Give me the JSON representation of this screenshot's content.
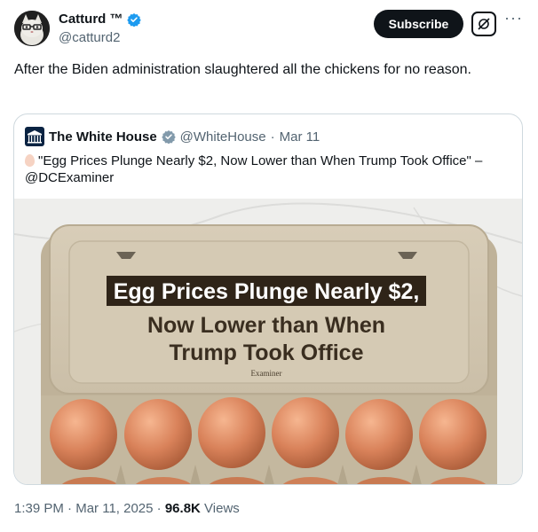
{
  "tweet": {
    "author_name": "Catturd ™",
    "handle": "@catturd2",
    "subscribe_label": "Subscribe",
    "more_label": "···",
    "text": "After the Biden administration slaughtered all the chickens for no reason."
  },
  "quote": {
    "author_name": "The White House",
    "handle": "@WhiteHouse",
    "separator": "·",
    "date": "Mar 11",
    "text": "\"Egg Prices Plunge Nearly $2, Now Lower than When Trump Took Office\" –@DCExaminer",
    "image": {
      "headline_line1": "Egg Prices Plunge Nearly $2,",
      "headline_line2": "Now Lower than When",
      "headline_line3": "Trump Took Office",
      "brand": "Examiner"
    }
  },
  "footer": {
    "time": "1:39 PM",
    "separator1": "·",
    "date": "Mar 11, 2025",
    "separator2": "·",
    "views_count": "96.8K",
    "views_label": "Views"
  },
  "colors": {
    "verified_blue": "#1d9bf0",
    "verified_gray": "#829aab",
    "muted_text": "#536471",
    "border": "#cfd9de"
  },
  "icons": [
    "verified-badge-icon",
    "grok-icon",
    "more-options-icon",
    "white-house-logo",
    "egg-emoji-icon"
  ]
}
